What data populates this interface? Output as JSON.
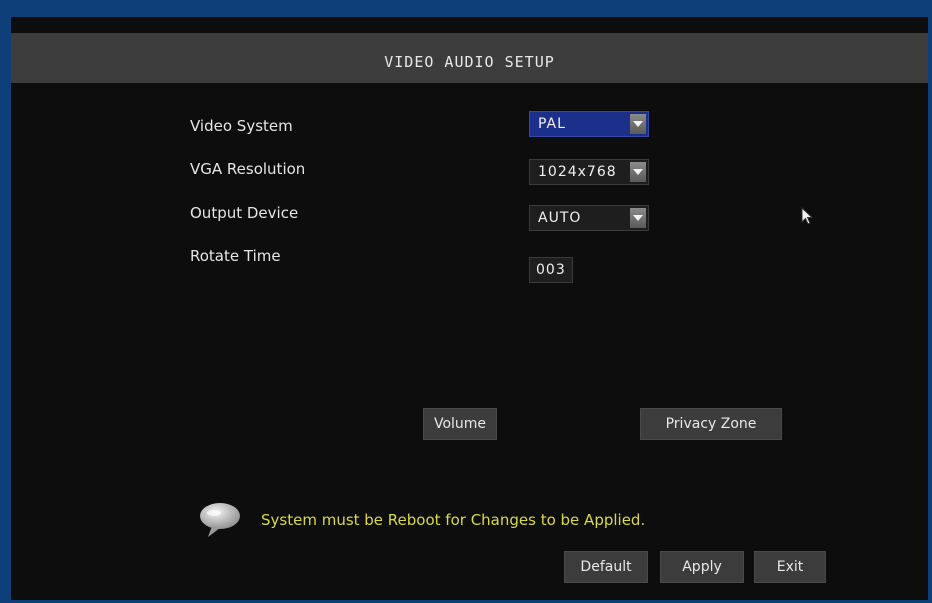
{
  "title": "VIDEO AUDIO SETUP",
  "fields": [
    {
      "label": "Video System",
      "value": "PAL"
    },
    {
      "label": "VGA  Resolution",
      "value": "1024x768"
    },
    {
      "label": "Output  Device",
      "value": "AUTO"
    },
    {
      "label": "Rotate  Time",
      "value": "003"
    }
  ],
  "buttons": {
    "volume": "Volume",
    "privacy_zone": "Privacy Zone",
    "default": "Default",
    "apply": "Apply",
    "exit": "Exit"
  },
  "notice": "System  must  be  Reboot  for  Changes  to  be  Applied.",
  "colors": {
    "frame": "#0f3f78",
    "screen": "#0d0d0d",
    "titlebar": "#3d3d3d",
    "selected": "#1c2f8a",
    "notice": "#d9d94a"
  },
  "icons": [
    "speech-bubble-icon",
    "mouse-cursor-icon",
    "dropdown-arrow-icon"
  ]
}
